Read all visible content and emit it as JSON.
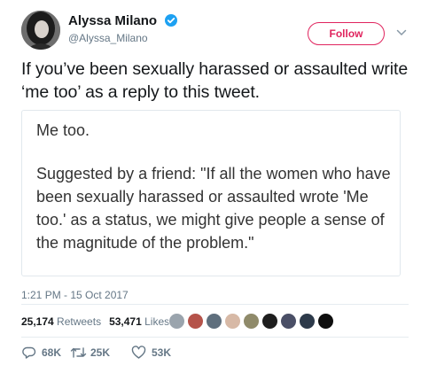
{
  "author": {
    "display_name": "Alyssa Milano",
    "handle": "@Alyssa_Milano",
    "verified": true
  },
  "follow_label": "Follow",
  "tweet": {
    "text": "If you’ve been sexually harassed or assaulted write ‘me too’ as a reply to this tweet.",
    "image_text": {
      "line1": "Me too.",
      "paragraph": "Suggested by a friend: \"If all the women who have been sexually harassed or assaulted wrote 'Me too.' as a status, we might give people a sense of the magnitude of the problem.\""
    },
    "timestamp": "1:21 PM - 15 Oct 2017"
  },
  "stats": {
    "retweets_count": "25,174",
    "retweets_label": "Retweets",
    "likes_count": "53,471",
    "likes_label": "Likes"
  },
  "actions": {
    "replies": "68K",
    "retweets": "25K",
    "likes": "53K"
  },
  "colors": {
    "follow_accent": "#e0245e",
    "verified_blue": "#1da1f2",
    "muted_text": "#657786"
  }
}
